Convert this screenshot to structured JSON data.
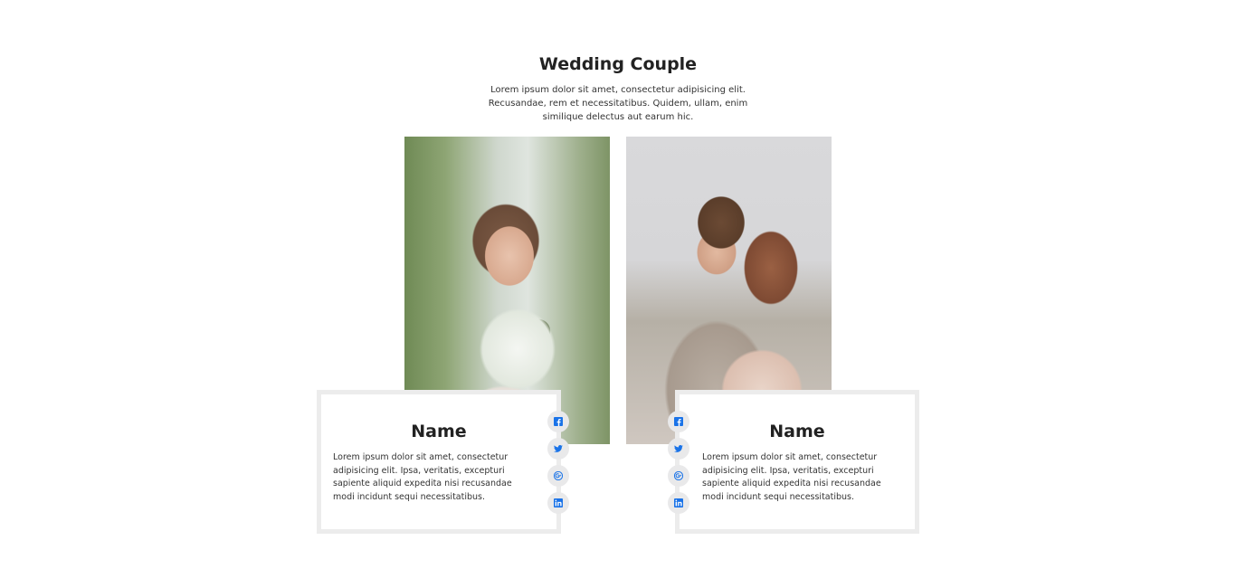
{
  "section": {
    "title": "Wedding Couple",
    "subtitle": "Lorem ipsum dolor sit amet, consectetur adipisicing elit. Recusandae, rem et necessitatibus. Quidem, ullam, enim similique delectus aut earum hic."
  },
  "bride": {
    "name": "Name",
    "bio": "Lorem ipsum dolor sit amet, consectetur adipisicing elit. Ipsa, veritatis, excepturi sapiente aliquid expedita nisi recusandae modi incidunt sequi necessitatibus."
  },
  "groom": {
    "name": "Name",
    "bio": "Lorem ipsum dolor sit amet, consectetur adipisicing elit. Ipsa, veritatis, excepturi sapiente aliquid expedita nisi recusandae modi incidunt sequi necessitatibus."
  },
  "social_icons": [
    "facebook-icon",
    "twitter-icon",
    "google-plus-icon",
    "linkedin-icon"
  ],
  "colors": {
    "icon_blue": "#1a73e8",
    "card_border": "#ececec",
    "icon_bg": "#e9e9ea"
  }
}
